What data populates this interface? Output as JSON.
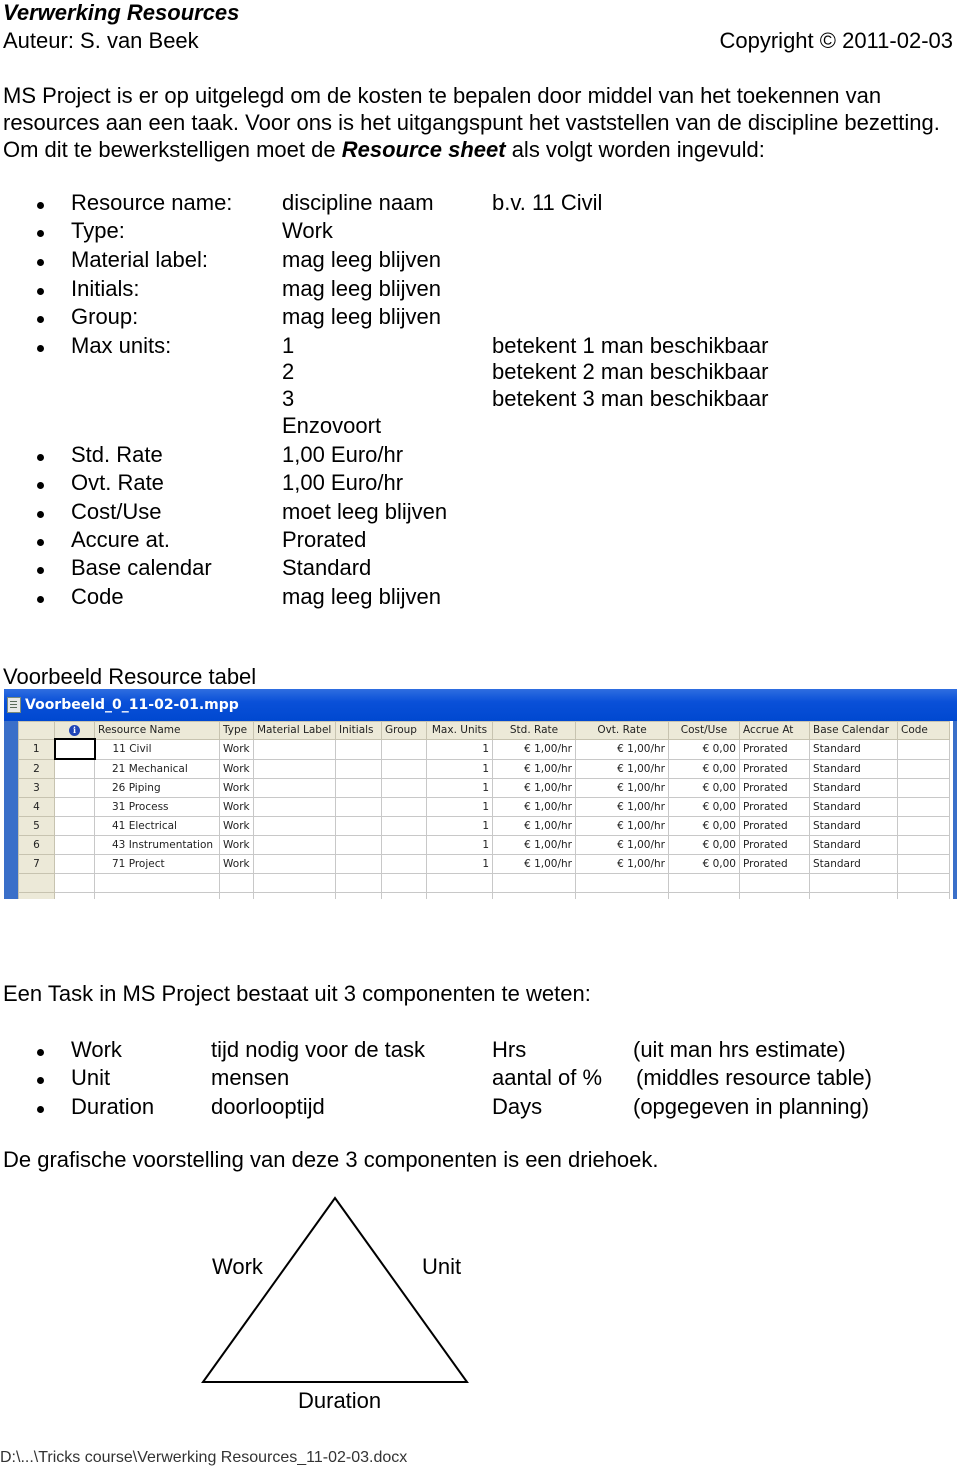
{
  "header": {
    "title": "Verwerking Resources",
    "author": "Auteur: S. van Beek",
    "copyright": "Copyright © 2011-02-03"
  },
  "intro": {
    "text_before": "MS Project is er op uitgelegd om de kosten te bepalen door middel van het toekennen van resources aan een taak. Voor ons is het uitgangspunt het vaststellen van de discipline bezetting. Om dit te bewerkstelligen moet de ",
    "emphasis": "Resource sheet",
    "text_after": " als volgt worden ingevuld:"
  },
  "resource_fields": [
    {
      "label": "Resource name:",
      "value": "discipline naam",
      "note": "b.v. 11 Civil"
    },
    {
      "label": "Type:",
      "value": "Work",
      "note": ""
    },
    {
      "label": "Material label:",
      "value": "mag leeg blijven",
      "note": ""
    },
    {
      "label": "Initials:",
      "value": "mag leeg blijven",
      "note": ""
    },
    {
      "label": "Group:",
      "value": "mag leeg blijven",
      "note": ""
    },
    {
      "label": "Max units:",
      "value": "1",
      "note": "betekent 1 man beschikbaar"
    },
    {
      "label": "",
      "value": "2",
      "note": "betekent 2 man beschikbaar"
    },
    {
      "label": "",
      "value": "3",
      "note": "betekent 3 man beschikbaar"
    },
    {
      "label": "",
      "value": "Enzovoort",
      "note": ""
    },
    {
      "label": "Std. Rate",
      "value": "1,00 Euro/hr",
      "note": ""
    },
    {
      "label": "Ovt. Rate",
      "value": "1,00 Euro/hr",
      "note": ""
    },
    {
      "label": "Cost/Use",
      "value": "moet leeg blijven",
      "note": ""
    },
    {
      "label": "Accure at.",
      "value": "Prorated",
      "note": ""
    },
    {
      "label": "Base calendar",
      "value": "Standard",
      "note": ""
    },
    {
      "label": "Code",
      "value": "mag leeg blijven",
      "note": ""
    }
  ],
  "example": {
    "section_title": "Voorbeeld Resource tabel",
    "window_title": "Voorbeeld_0_11-02-01.mpp",
    "window_icon": "document-icon",
    "columns": [
      "",
      "i",
      "Resource Name",
      "Type",
      "Material Label",
      "Initials",
      "Group",
      "Max. Units",
      "Std. Rate",
      "Ovt. Rate",
      "Cost/Use",
      "Accrue At",
      "Base Calendar",
      "Code"
    ],
    "rows": [
      {
        "id": "1",
        "name": "11 Civil",
        "type": "Work",
        "material": "",
        "initials": "",
        "group": "",
        "max_units": "1",
        "std_rate": "€ 1,00/hr",
        "ovt_rate": "€ 1,00/hr",
        "cost_use": "€ 0,00",
        "accrue": "Prorated",
        "calendar": "Standard",
        "code": ""
      },
      {
        "id": "2",
        "name": "21 Mechanical",
        "type": "Work",
        "material": "",
        "initials": "",
        "group": "",
        "max_units": "1",
        "std_rate": "€ 1,00/hr",
        "ovt_rate": "€ 1,00/hr",
        "cost_use": "€ 0,00",
        "accrue": "Prorated",
        "calendar": "Standard",
        "code": ""
      },
      {
        "id": "3",
        "name": "26 Piping",
        "type": "Work",
        "material": "",
        "initials": "",
        "group": "",
        "max_units": "1",
        "std_rate": "€ 1,00/hr",
        "ovt_rate": "€ 1,00/hr",
        "cost_use": "€ 0,00",
        "accrue": "Prorated",
        "calendar": "Standard",
        "code": ""
      },
      {
        "id": "4",
        "name": "31 Process",
        "type": "Work",
        "material": "",
        "initials": "",
        "group": "",
        "max_units": "1",
        "std_rate": "€ 1,00/hr",
        "ovt_rate": "€ 1,00/hr",
        "cost_use": "€ 0,00",
        "accrue": "Prorated",
        "calendar": "Standard",
        "code": ""
      },
      {
        "id": "5",
        "name": "41 Electrical",
        "type": "Work",
        "material": "",
        "initials": "",
        "group": "",
        "max_units": "1",
        "std_rate": "€ 1,00/hr",
        "ovt_rate": "€ 1,00/hr",
        "cost_use": "€ 0,00",
        "accrue": "Prorated",
        "calendar": "Standard",
        "code": ""
      },
      {
        "id": "6",
        "name": "43 Instrumentation",
        "type": "Work",
        "material": "",
        "initials": "",
        "group": "",
        "max_units": "1",
        "std_rate": "€ 1,00/hr",
        "ovt_rate": "€ 1,00/hr",
        "cost_use": "€ 0,00",
        "accrue": "Prorated",
        "calendar": "Standard",
        "code": ""
      },
      {
        "id": "7",
        "name": "71 Project",
        "type": "Work",
        "material": "",
        "initials": "",
        "group": "",
        "max_units": "1",
        "std_rate": "€ 1,00/hr",
        "ovt_rate": "€ 1,00/hr",
        "cost_use": "€ 0,00",
        "accrue": "Prorated",
        "calendar": "Standard",
        "code": ""
      }
    ]
  },
  "task": {
    "intro": "Een Task in MS Project bestaat uit 3 componenten te weten:",
    "components": [
      {
        "name": "Work",
        "description": "tijd nodig voor de task",
        "unit": "Hrs",
        "note": "(uit man hrs estimate)"
      },
      {
        "name": "Unit",
        "description": "mensen",
        "unit": "aantal of %",
        "note": "(middles resource table)"
      },
      {
        "name": "Duration",
        "description": "doorlooptijd",
        "unit": "Days",
        "note": "(opgegeven in planning)"
      }
    ],
    "diagram_intro": "De grafische voorstelling van deze 3 componenten is een driehoek.",
    "triangle_labels": {
      "left": "Work",
      "right": "Unit",
      "bottom": "Duration"
    }
  },
  "footer": {
    "text": "D:\\...\\Tricks course\\Verwerking Resources_11-02-03.docx"
  }
}
